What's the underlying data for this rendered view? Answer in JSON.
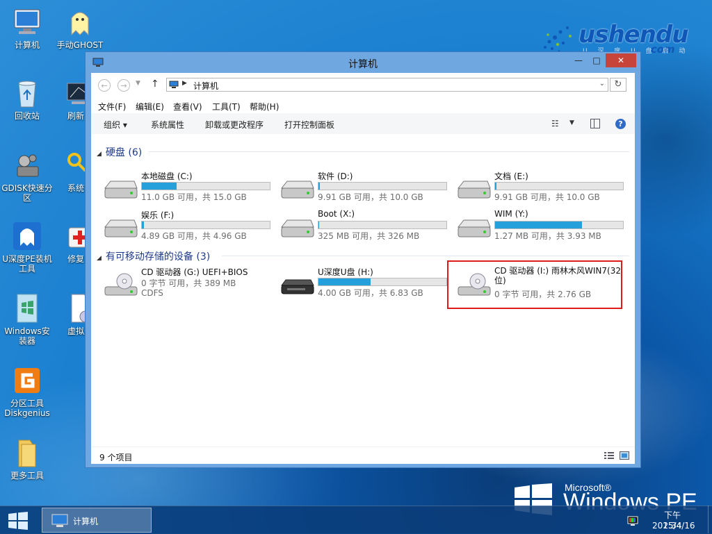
{
  "brand": {
    "name": "ushendu",
    "suffix": ".com",
    "tagline": "U 深 度 U 盘 启 动"
  },
  "winpe": {
    "microsoft": "Microsoft®",
    "product": "Windows PE"
  },
  "desktop_icons": [
    {
      "label": "计算机",
      "icon": "computer-icon"
    },
    {
      "label": "手动GHOST",
      "icon": "ghost-icon"
    },
    {
      "label": "回收站",
      "icon": "recycle-bin-icon"
    },
    {
      "label": "刷新桌",
      "icon": "refresh-desktop-icon"
    },
    {
      "label": "GDISK快速分区",
      "icon": "gdisk-icon"
    },
    {
      "label": "系统密",
      "icon": "key-icon"
    },
    {
      "label": "U深度PE装机工具",
      "icon": "pe-installer-icon"
    },
    {
      "label": "修复系",
      "icon": "repair-icon"
    },
    {
      "label": "Windows安装器",
      "icon": "windows-installer-icon"
    },
    {
      "label": "虚拟光",
      "icon": "virtual-drive-icon"
    },
    {
      "label": "分区工具Diskgenius",
      "icon": "diskgenius-icon"
    },
    {
      "label": "更多工具",
      "icon": "folder-icon"
    }
  ],
  "window": {
    "title": "计算机",
    "address": "计算机",
    "controls": {
      "minimize": "—",
      "maximize": "□",
      "close": "✕"
    },
    "menu": [
      "文件(F)",
      "编辑(E)",
      "查看(V)",
      "工具(T)",
      "帮助(H)"
    ],
    "toolbar": [
      "组织 ▾",
      "系统属性",
      "卸载或更改程序",
      "打开控制面板"
    ],
    "groups": {
      "hard_disks": {
        "title": "硬盘 (6)"
      },
      "removable": {
        "title": "有可移动存储的设备 (3)"
      }
    },
    "hard_disks": [
      {
        "name": "本地磁盘 (C:)",
        "free": "11.0 GB 可用，共 15.0 GB",
        "used_fraction": 0.27
      },
      {
        "name": "软件 (D:)",
        "free": "9.91 GB 可用，共 10.0 GB",
        "used_fraction": 0.01
      },
      {
        "name": "文档 (E:)",
        "free": "9.91 GB 可用，共 10.0 GB",
        "used_fraction": 0.01
      },
      {
        "name": "娱乐 (F:)",
        "free": "4.89 GB 可用，共 4.96 GB",
        "used_fraction": 0.014
      },
      {
        "name": "Boot (X:)",
        "free": "325 MB 可用，共 326 MB",
        "used_fraction": 0.003
      },
      {
        "name": "WIM (Y:)",
        "free": "1.27 MB 可用，共 3.93 MB",
        "used_fraction": 0.68
      }
    ],
    "removable": [
      {
        "name": "CD 驱动器 (G:) UEFI+BIOS",
        "free": "0 字节 可用，共 389 MB",
        "fs": "CDFS"
      },
      {
        "name": "U深度U盘 (H:)",
        "free": "4.00 GB 可用，共 6.83 GB",
        "used_fraction": 0.41
      },
      {
        "name": "CD 驱动器 (I:) 雨林木风WIN7(32位)",
        "free": "0 字节 可用，共 2.76 GB"
      }
    ],
    "status": "9 个项目"
  },
  "taskbar": {
    "task_label": "计算机",
    "time": "下午 2:34",
    "date": "2015/4/16"
  },
  "colors": {
    "accent": "#26a0da",
    "highlight": "#e01a1a",
    "close": "#c7443a"
  }
}
